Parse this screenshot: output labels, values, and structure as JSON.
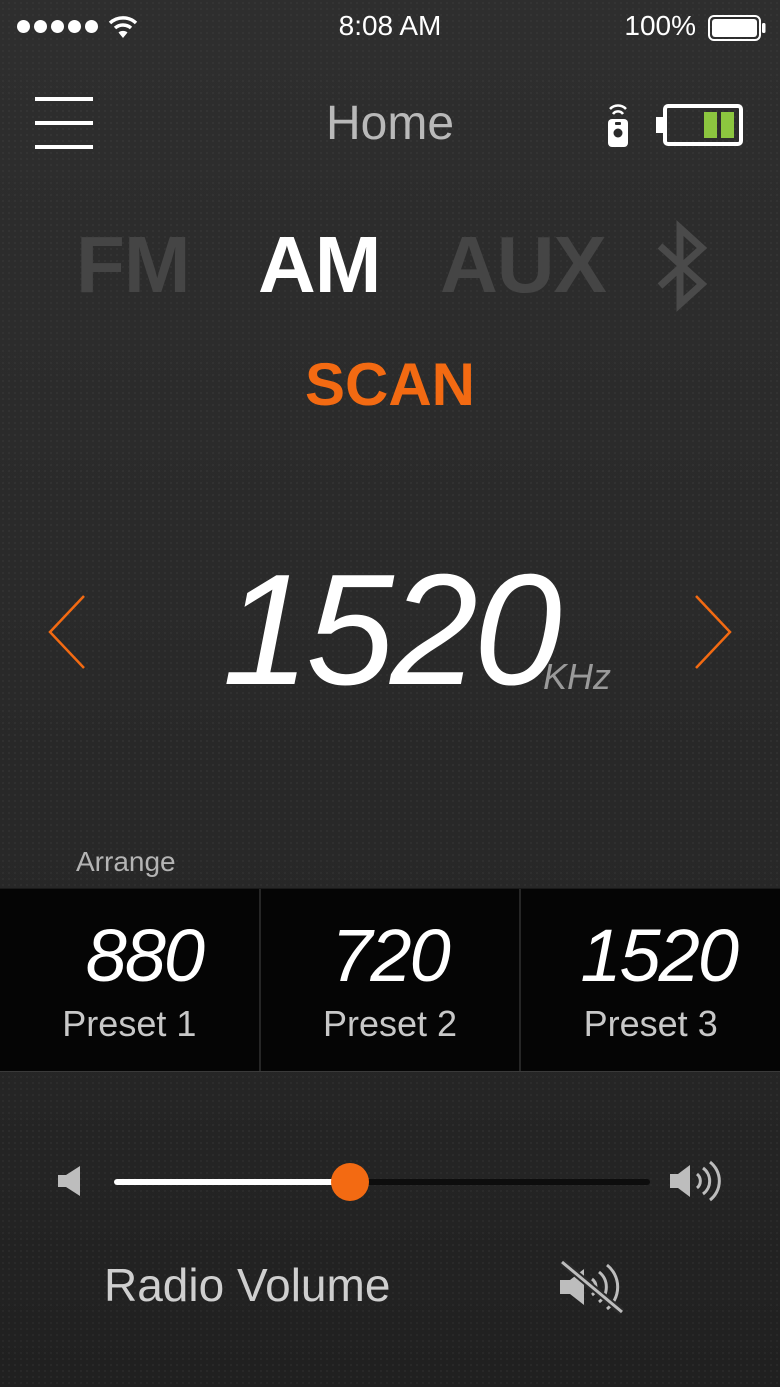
{
  "status_bar": {
    "time": "8:08 AM",
    "battery_percent": "100%"
  },
  "header": {
    "title": "Home"
  },
  "sources": {
    "fm": "FM",
    "am": "AM",
    "aux": "AUX",
    "selected": "AM"
  },
  "scan_label": "SCAN",
  "tuner": {
    "frequency": "1520",
    "unit": "KHz"
  },
  "presets": {
    "arrange_label": "Arrange",
    "items": [
      {
        "value": "880",
        "label": "Preset 1"
      },
      {
        "value": "720",
        "label": "Preset 2"
      },
      {
        "value": "1520",
        "label": "Preset 3"
      }
    ]
  },
  "volume": {
    "label": "Radio Volume",
    "level": 0.44
  },
  "colors": {
    "accent": "#f36a12",
    "battery_green": "#8cc63f"
  },
  "icons": [
    "menu-icon",
    "remote-icon",
    "device-battery-icon",
    "bluetooth-icon",
    "chevron-left-icon",
    "chevron-right-icon",
    "speaker-low-icon",
    "speaker-high-icon",
    "mute-icon"
  ]
}
